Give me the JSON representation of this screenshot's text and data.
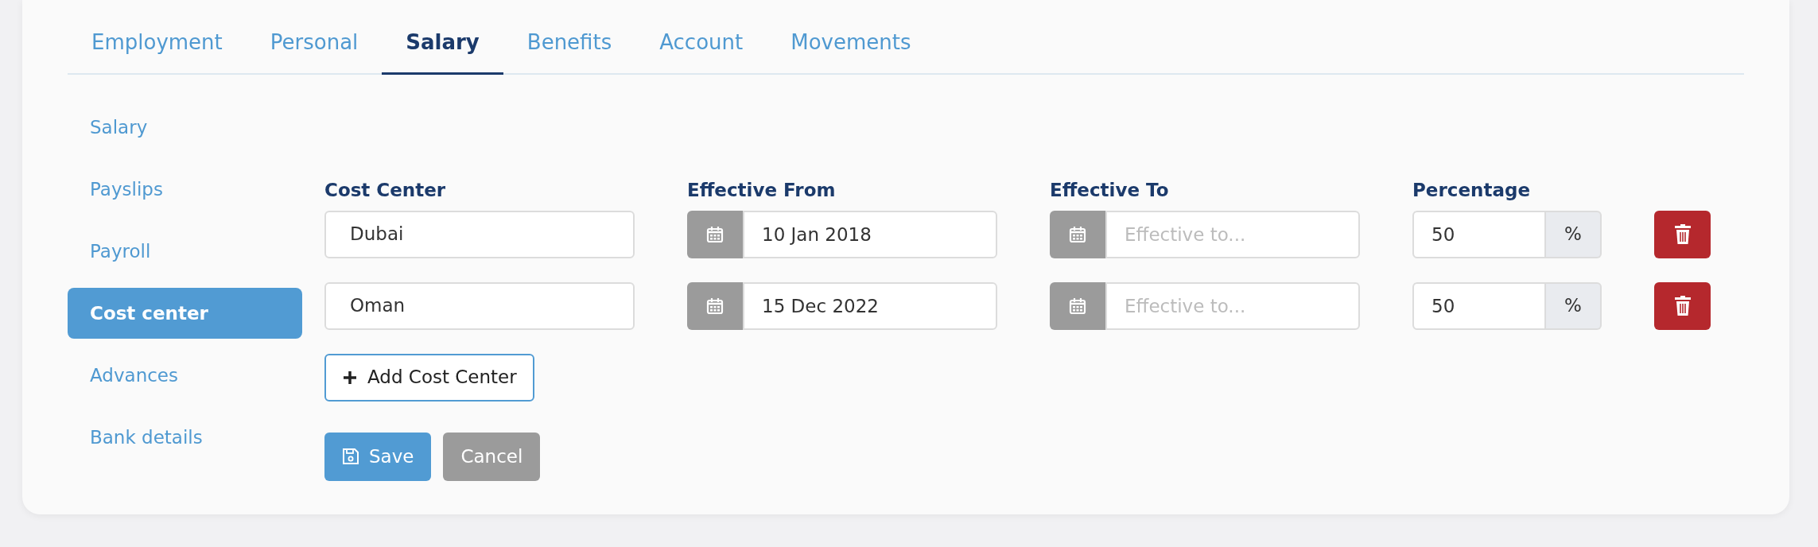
{
  "tabs": [
    {
      "label": "Employment",
      "selected": false
    },
    {
      "label": "Personal",
      "selected": false
    },
    {
      "label": "Salary",
      "selected": true
    },
    {
      "label": "Benefits",
      "selected": false
    },
    {
      "label": "Account",
      "selected": false
    },
    {
      "label": "Movements",
      "selected": false
    }
  ],
  "sidebar": {
    "items": [
      {
        "label": "Salary",
        "selected": false
      },
      {
        "label": "Payslips",
        "selected": false
      },
      {
        "label": "Payroll",
        "selected": false
      },
      {
        "label": "Cost center",
        "selected": true
      },
      {
        "label": "Advances",
        "selected": false
      },
      {
        "label": "Bank details",
        "selected": false
      }
    ]
  },
  "form": {
    "columns": [
      "Cost Center",
      "Effective From",
      "Effective To",
      "Percentage"
    ],
    "rows": [
      {
        "cost_center": "Dubai",
        "effective_from": {
          "value": "10 Jan 2018"
        },
        "effective_to": {
          "placeholder": "Effective to..."
        },
        "percentage": "50",
        "unit": "%"
      },
      {
        "cost_center": "Oman",
        "effective_from": {
          "value": "15 Dec 2022"
        },
        "effective_to": {
          "placeholder": "Effective to..."
        },
        "percentage": "50",
        "unit": "%"
      }
    ],
    "add_button": "Add Cost Center",
    "buttons": [
      "Save",
      "Cancel"
    ]
  }
}
